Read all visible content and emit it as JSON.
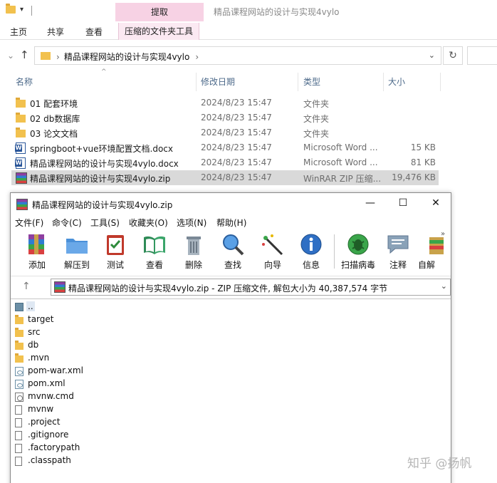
{
  "explorer": {
    "context_tab": "提取",
    "title": "精品课程网站的设计与实现4vylo",
    "ribbon_tabs": [
      "主页",
      "共享",
      "查看",
      "压缩的文件夹工具"
    ],
    "address_path": "精品课程网站的设计与实现4vylo",
    "columns": [
      "名称",
      "修改日期",
      "类型",
      "大小"
    ],
    "files": [
      {
        "name": "01 配套环境",
        "date": "2024/8/23 15:47",
        "type": "文件夹",
        "size": "",
        "icon": "folder-icon"
      },
      {
        "name": "02 db数据库",
        "date": "2024/8/23 15:47",
        "type": "文件夹",
        "size": "",
        "icon": "folder-icon"
      },
      {
        "name": "03 论文文档",
        "date": "2024/8/23 15:47",
        "type": "文件夹",
        "size": "",
        "icon": "folder-icon"
      },
      {
        "name": "springboot+vue环境配置文档.docx",
        "date": "2024/8/23 15:47",
        "type": "Microsoft Word ...",
        "size": "15 KB",
        "icon": "word-doc-icon"
      },
      {
        "name": "精品课程网站的设计与实现4vylo.docx",
        "date": "2024/8/23 15:47",
        "type": "Microsoft Word ...",
        "size": "81 KB",
        "icon": "word-doc-icon"
      },
      {
        "name": "精品课程网站的设计与实现4vylo.zip",
        "date": "2024/8/23 15:47",
        "type": "WinRAR ZIP 压缩...",
        "size": "19,476 KB",
        "icon": "winrar-archive-icon",
        "selected": true
      }
    ]
  },
  "winrar": {
    "title": "精品课程网站的设计与实现4vylo.zip",
    "window_buttons": {
      "minimize": "—",
      "maximize": "☐",
      "close": "✕"
    },
    "menu": [
      "文件(F)",
      "命令(C)",
      "工具(S)",
      "收藏夹(O)",
      "选项(N)",
      "帮助(H)"
    ],
    "toolbar": [
      {
        "label": "添加",
        "icon": "add-archive-icon"
      },
      {
        "label": "解压到",
        "icon": "extract-to-icon"
      },
      {
        "label": "测试",
        "icon": "test-clipboard-icon"
      },
      {
        "label": "查看",
        "icon": "view-book-icon"
      },
      {
        "label": "删除",
        "icon": "trash-icon"
      },
      {
        "label": "查找",
        "icon": "magnifier-icon"
      },
      {
        "label": "向导",
        "icon": "wizard-wand-icon"
      },
      {
        "label": "信息",
        "icon": "info-icon"
      },
      {
        "label": "扫描病毒",
        "icon": "virus-scan-icon"
      },
      {
        "label": "注释",
        "icon": "comment-icon"
      },
      {
        "label": "自解",
        "icon": "sfx-box-icon"
      }
    ],
    "path_text": "精品课程网站的设计与实现4vylo.zip - ZIP 压缩文件, 解包大小为 40,387,574 字节",
    "entries": [
      {
        "name": "..",
        "icon": "up-folder-icon"
      },
      {
        "name": "target",
        "icon": "folder-icon"
      },
      {
        "name": "src",
        "icon": "folder-icon"
      },
      {
        "name": "db",
        "icon": "folder-icon"
      },
      {
        "name": ".mvn",
        "icon": "folder-icon"
      },
      {
        "name": "pom-war.xml",
        "icon": "xml-file-icon"
      },
      {
        "name": "pom.xml",
        "icon": "xml-file-icon"
      },
      {
        "name": "mvnw.cmd",
        "icon": "cmd-file-icon"
      },
      {
        "name": "mvnw",
        "icon": "file-icon"
      },
      {
        "name": ".project",
        "icon": "file-icon"
      },
      {
        "name": ".gitignore",
        "icon": "file-icon"
      },
      {
        "name": ".factorypath",
        "icon": "file-icon"
      },
      {
        "name": ".classpath",
        "icon": "file-icon"
      }
    ]
  },
  "watermark": "知乎 @扬帆"
}
